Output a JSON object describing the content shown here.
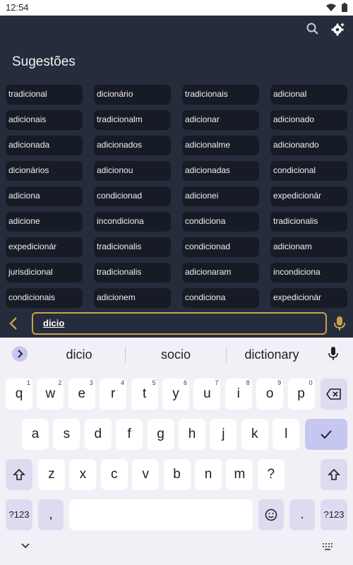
{
  "status_bar": {
    "time": "12:54"
  },
  "app": {
    "title": "Sugestões",
    "suggestions": [
      "tradicional",
      "dicionário",
      "tradicionais",
      "adicional",
      "adicionais",
      "tradicionalm",
      "adicionar",
      "adicionado",
      "adicionada",
      "adicionados",
      "adicionalme",
      "adicionando",
      "dicionários",
      "adicionou",
      "adicionadas",
      "condicional",
      "adiciona",
      "condicionad",
      "adicionei",
      "expedicionár",
      "adicione",
      "incondiciona",
      "condiciona",
      "tradicionalis",
      "expedicionár",
      "tradicionalis",
      "condicionad",
      "adicionam",
      "jurisdicional",
      "tradicionalis",
      "adicionaram",
      "incondiciona",
      "condicionais",
      "adicionem",
      "condiciona",
      "expedicionár"
    ],
    "input": {
      "value": "dicio"
    }
  },
  "keyboard": {
    "suggestions": [
      "dicio",
      "socio",
      "dictionary"
    ],
    "row1": [
      {
        "k": "q",
        "h": "1"
      },
      {
        "k": "w",
        "h": "2"
      },
      {
        "k": "e",
        "h": "3"
      },
      {
        "k": "r",
        "h": "4"
      },
      {
        "k": "t",
        "h": "5"
      },
      {
        "k": "y",
        "h": "6"
      },
      {
        "k": "u",
        "h": "7"
      },
      {
        "k": "i",
        "h": "8"
      },
      {
        "k": "o",
        "h": "9"
      },
      {
        "k": "p",
        "h": "0"
      }
    ],
    "row2": [
      "a",
      "s",
      "d",
      "f",
      "g",
      "h",
      "j",
      "k",
      "l"
    ],
    "row3": [
      "z",
      "x",
      "c",
      "v",
      "b",
      "n",
      "m",
      "?"
    ],
    "symbols_label": "?123",
    "comma": ",",
    "period": "."
  },
  "colors": {
    "accent": "#c9a24b",
    "chip_bg": "#171b26",
    "app_bg": "#252c3c",
    "key_action": "#c6c7f0"
  }
}
